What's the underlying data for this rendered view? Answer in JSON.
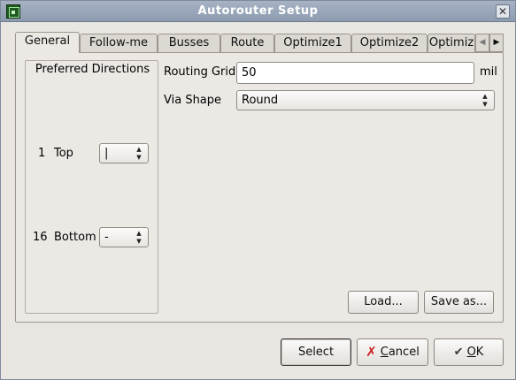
{
  "window": {
    "title": "Autorouter Setup",
    "close_glyph": "✕"
  },
  "tabs": [
    {
      "label": "General",
      "active": true
    },
    {
      "label": "Follow-me"
    },
    {
      "label": "Busses"
    },
    {
      "label": "Route"
    },
    {
      "label": "Optimize1"
    },
    {
      "label": "Optimize2"
    },
    {
      "label": "Optimiz"
    }
  ],
  "tab_scroll": {
    "left_glyph": "◀",
    "right_glyph": "▶"
  },
  "preferred_directions": {
    "title": "Preferred Directions",
    "layers": [
      {
        "number": "1",
        "name": "Top",
        "value": "|"
      },
      {
        "number": "16",
        "name": "Bottom",
        "value": "-"
      }
    ]
  },
  "routing_grid": {
    "label": "Routing Grid",
    "value": "50",
    "unit": "mil"
  },
  "via_shape": {
    "label": "Via Shape",
    "value": "Round"
  },
  "buttons": {
    "load": "Load...",
    "save_as": "Save as...",
    "select": "Select",
    "cancel_mnemonic": "C",
    "cancel_rest": "ancel",
    "ok_mnemonic": "O",
    "ok_rest": "K"
  },
  "icons": {
    "app": "board-icon",
    "cancel": "x-icon",
    "ok": "check-icon"
  }
}
